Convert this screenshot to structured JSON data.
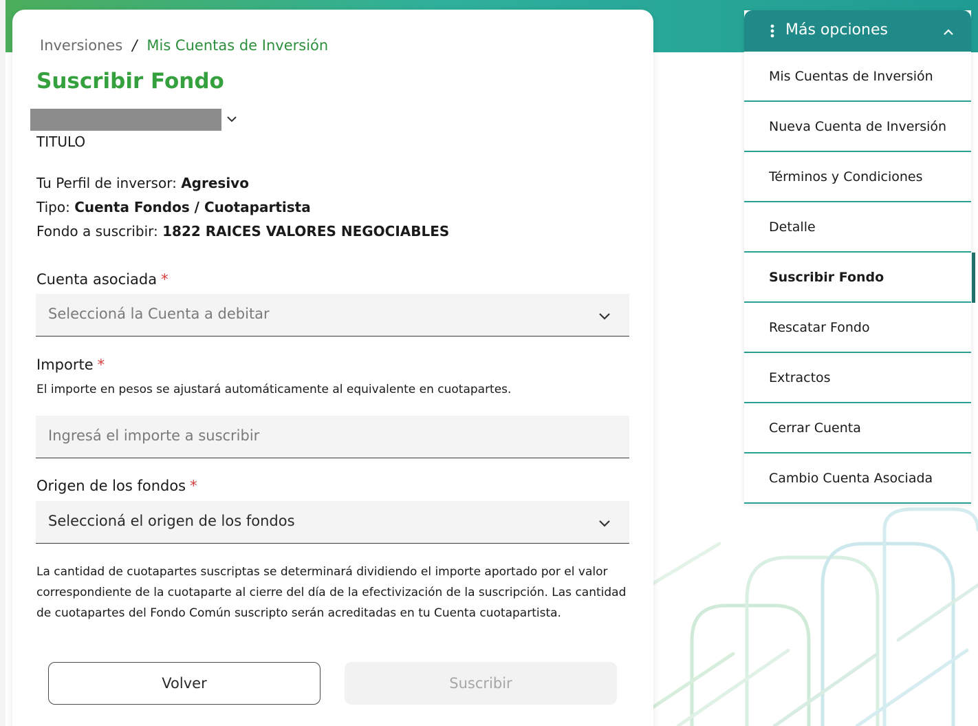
{
  "breadcrumb": {
    "root": "Inversiones",
    "separator": "/",
    "current": "Mis Cuentas de Inversión"
  },
  "page": {
    "title": "Suscribir Fondo",
    "account_label": "TITULO"
  },
  "profile": {
    "perfil_label": "Tu Perfil de inversor:",
    "perfil_value": "Agresivo",
    "tipo_label": "Tipo:",
    "tipo_value": "Cuenta Fondos / Cuotapartista",
    "fondo_label": "Fondo a suscribir:",
    "fondo_value": "1822 RAICES VALORES NEGOCIABLES"
  },
  "form": {
    "required_mark": "*",
    "cuenta": {
      "label": "Cuenta asociada",
      "placeholder": "Seleccioná la Cuenta a debitar"
    },
    "importe": {
      "label": "Importe",
      "hint": "El importe en pesos se ajustará automáticamente al equivalente en cuotapartes.",
      "placeholder": "Ingresá el importe a suscribir"
    },
    "origen": {
      "label": "Origen de los fondos",
      "value": "Seleccioná el origen de los fondos"
    },
    "disclaimer": "La cantidad de cuotapartes suscriptas se determinará dividiendo el importe aportado por el valor correspondiente de la cuotaparte al cierre del día de la efectivización de la suscripción. Las cantidad de cuotapartes del Fondo Común suscripto serán acreditadas en tu Cuenta cuotapartista."
  },
  "buttons": {
    "back": "Volver",
    "submit": "Suscribir"
  },
  "options_panel": {
    "title": "Más opciones",
    "items": [
      {
        "label": "Mis Cuentas de Inversión"
      },
      {
        "label": "Nueva Cuenta de Inversión"
      },
      {
        "label": "Términos y Condiciones"
      },
      {
        "label": "Detalle"
      },
      {
        "label": "Suscribir Fondo"
      },
      {
        "label": "Rescatar Fondo"
      },
      {
        "label": "Extractos"
      },
      {
        "label": "Cerrar Cuenta"
      },
      {
        "label": "Cambio Cuenta Asociada"
      }
    ],
    "active_item": "Suscribir Fondo"
  },
  "colors": {
    "brand_green": "#35a03e",
    "teal": "#1f8a87",
    "required_red": "#d63a3a"
  },
  "icons": {
    "account_dropdown": "chevron-down-icon",
    "options_menu": "kebab-icon",
    "options_collapse": "chevron-up-icon"
  }
}
